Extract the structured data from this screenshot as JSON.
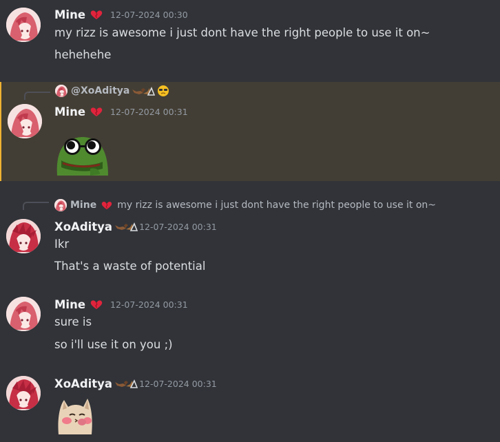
{
  "messages": [
    {
      "username": "Mine",
      "timestamp": "12-07-2024 00:30",
      "lines": [
        "my rizz is awesome i just dont have the right people to use it on~",
        "hehehehe"
      ]
    },
    {
      "reply": {
        "mention": "@XoAditya"
      },
      "username": "Mine",
      "timestamp": "12-07-2024 00:31",
      "sticker": "pepe-sunglasses-icon"
    },
    {
      "reply": {
        "name": "Mine",
        "text": "my rizz is awesome i just dont have the right people to use it on~"
      },
      "username": "XoAditya",
      "timestamp": "12-07-2024 00:31",
      "lines": [
        "Ikr",
        "That's a waste of potential"
      ]
    },
    {
      "username": "Mine",
      "timestamp": "12-07-2024 00:31",
      "lines": [
        "sure is",
        "so i'll use it on you ;)"
      ]
    },
    {
      "username": "XoAditya",
      "timestamp": "12-07-2024 00:31",
      "sticker": "blushing-cat-icon"
    }
  ],
  "colors": {
    "background": "#313338",
    "highlight": "#433e35",
    "username": "#f2f3f5",
    "text": "#dbdee1",
    "timestamp": "#949ba4",
    "badge_heart": "#e0243c"
  }
}
